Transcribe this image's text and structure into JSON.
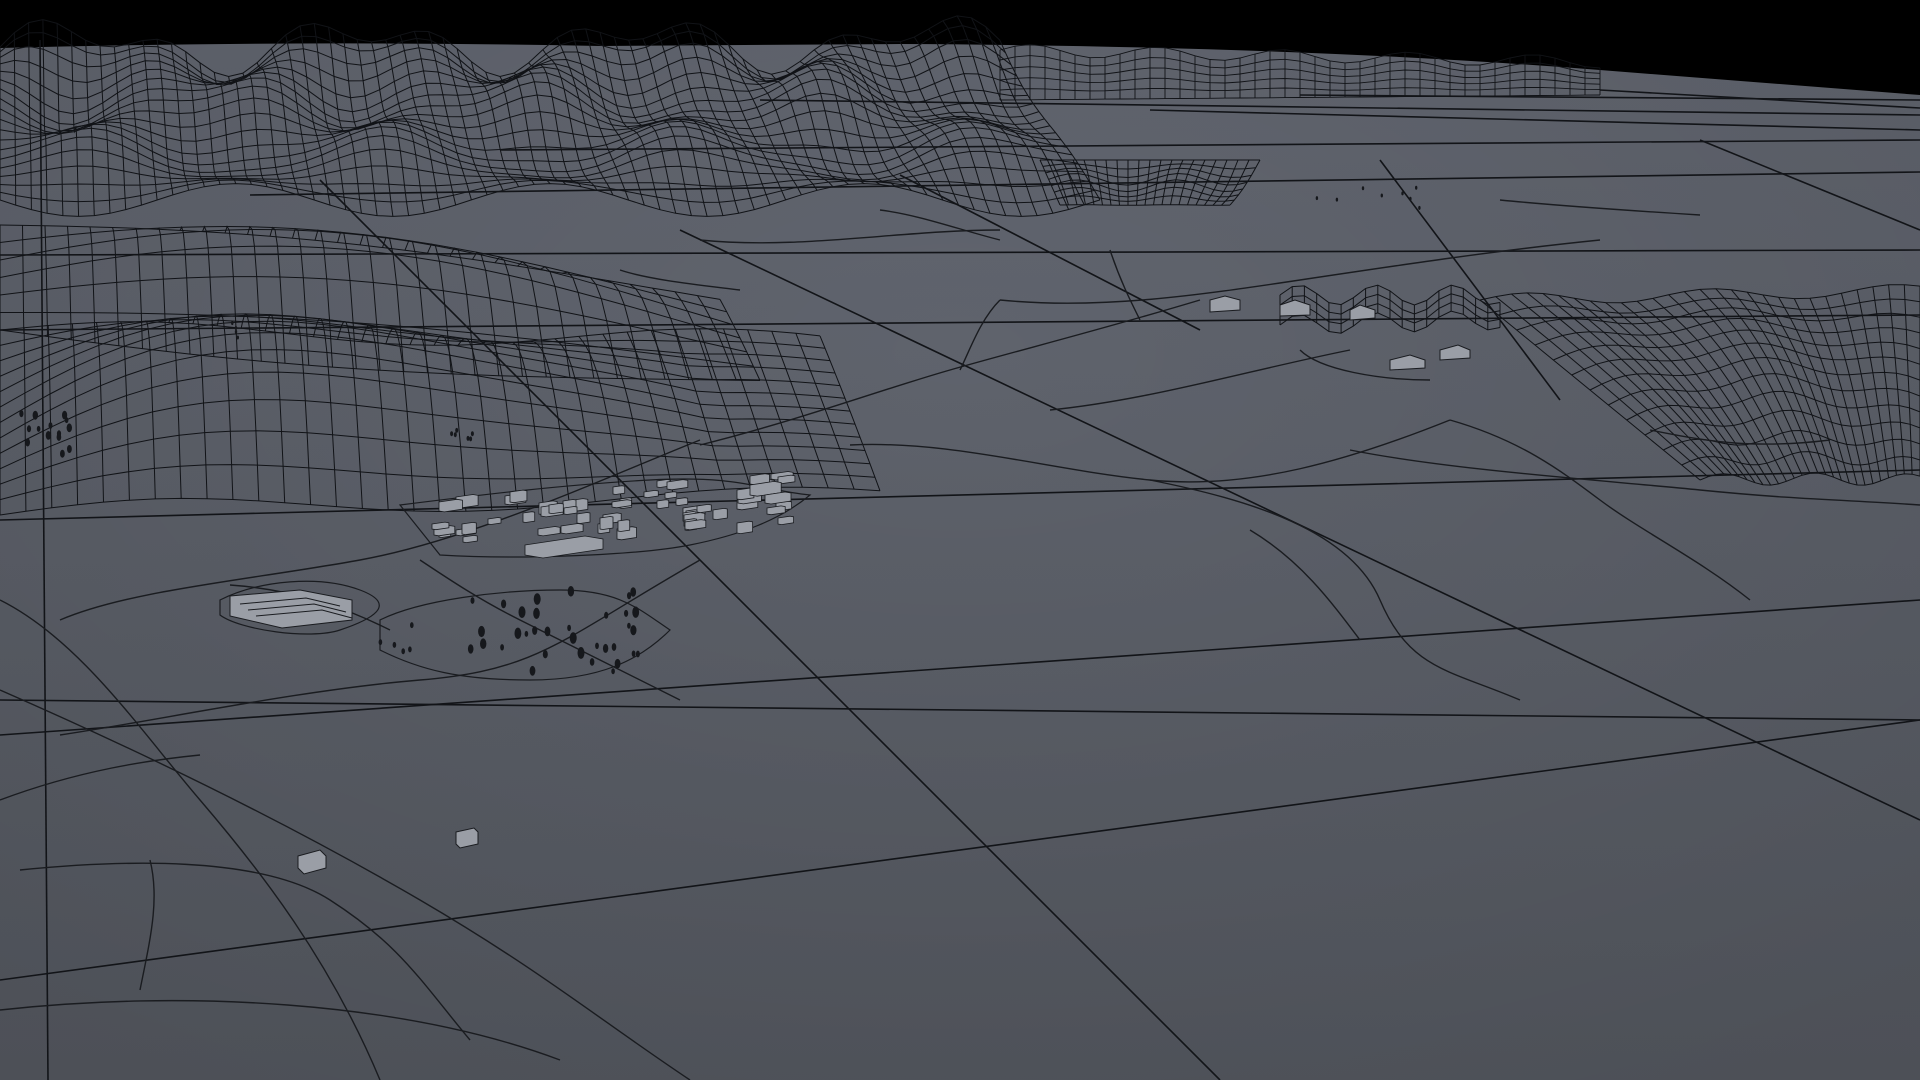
{
  "scene": {
    "kind": "wireframe terrain render",
    "sky_color": "#000000",
    "ground_color": "#5a5e66",
    "ground_far_color": "#60646c",
    "line_color": "#111317",
    "road_color": "#1a1c20",
    "building_color": "#9a9ea6",
    "elements": [
      "grid-lines",
      "wireframe-hills-left",
      "wireframe-mountains-far",
      "wireframe-hills-right",
      "village",
      "roads",
      "trees",
      "farm-buildings",
      "isolated-buildings"
    ]
  }
}
